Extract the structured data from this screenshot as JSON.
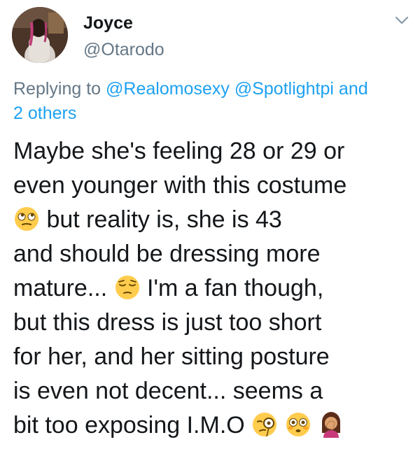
{
  "author": {
    "name": "Joyce",
    "handle": "@Otarodo"
  },
  "reply": {
    "prefix": "Replying to",
    "mention_1": "@Realomosexy",
    "mention_2": "@Spotlightpi",
    "and_text": "and",
    "others": "2 others"
  },
  "tweet": {
    "line_1": "Maybe she's feeling 28 or 29 or",
    "line_2": "even younger with this costume",
    "line_3": " but reality is, she is 43",
    "line_4": "and should be dressing more",
    "line_5a": "mature... ",
    "line_5b": " I'm a fan though,",
    "line_6": "but this dress is just too short",
    "line_7": "for her, and her sitting posture",
    "line_8": "is even not decent... seems a",
    "line_9": "bit too exposing I.M.O "
  },
  "icons": {
    "menu": "chevron-down-icon",
    "emoji_1": "face-with-rolling-eyes",
    "emoji_2": "pensive-face",
    "emoji_3": "face-with-monocle",
    "emoji_4": "flushed-face",
    "emoji_5": "woman-facepalming"
  },
  "colors": {
    "link": "#1da1f2",
    "muted": "#657786",
    "text": "#14171a"
  }
}
